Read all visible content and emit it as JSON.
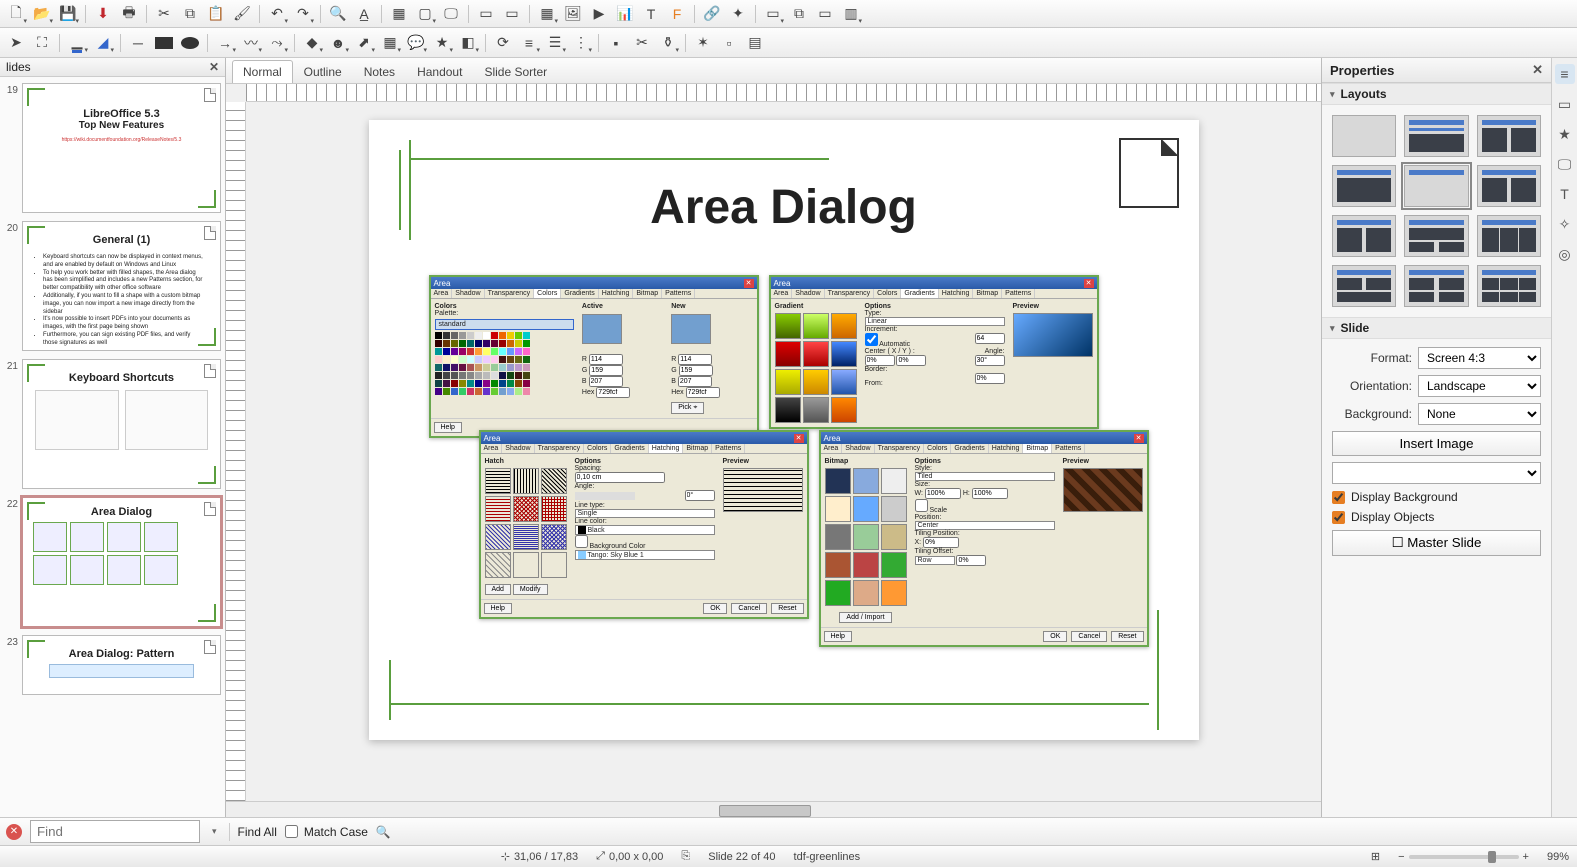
{
  "toolbar1": [
    "new",
    "open",
    "save",
    "pdf",
    "print",
    "cut",
    "copy",
    "paste",
    "clone",
    "undo",
    "redo",
    "find",
    "spell",
    "grid",
    "snap",
    "display",
    "nav",
    "nav2",
    "nav3",
    "table",
    "image",
    "media",
    "chart",
    "textbox",
    "fontwork",
    "hyperlink",
    "anim",
    "s1",
    "s2",
    "s3",
    "s4",
    "s5"
  ],
  "view_tabs": [
    "Normal",
    "Outline",
    "Notes",
    "Handout",
    "Slide Sorter"
  ],
  "active_view_tab": 0,
  "slides_panel": {
    "title": "lides"
  },
  "slides": [
    {
      "num": 19,
      "title": "LibreOffice 5.3",
      "subtitle": "Top New Features",
      "link": "https://wiki.documentfoundation.org/ReleaseNotes/5.3"
    },
    {
      "num": 20,
      "title": "General (1)",
      "bullets": [
        "Keyboard shortcuts can now be displayed in context menus, and are enabled by default on Windows and Linux",
        "To help you work better with filled shapes, the Area dialog has been simplified and includes a new Patterns section, for better compatibility with other office software",
        "Additionally, if you want to fill a shape with a custom bitmap image, you can now import a new image directly from the sidebar",
        "It's now possible to insert PDFs into your documents as images, with the first page being shown",
        "Furthermore, you can sign existing PDF files, and verify those signatures as well"
      ]
    },
    {
      "num": 21,
      "title": "Keyboard Shortcuts"
    },
    {
      "num": 22,
      "title": "Area Dialog",
      "selected": true
    },
    {
      "num": 23,
      "title": "Area Dialog: Pattern"
    }
  ],
  "canvas": {
    "title": "Area Dialog",
    "dialogs": {
      "colors": {
        "title": "Area",
        "tabs": [
          "Area",
          "Shadow",
          "Transparency",
          "Colors",
          "Gradients",
          "Hatching",
          "Bitmap",
          "Patterns"
        ],
        "active": 3,
        "labels": {
          "colors": "Colors",
          "active": "Active",
          "new": "New",
          "palette": "Palette:",
          "r": "R",
          "g": "G",
          "b": "B",
          "hex": "Hex"
        },
        "palette_value": "standard",
        "r": "114",
        "g": "159",
        "b": "207",
        "hex": "729fcf",
        "pick": "Pick ⌖",
        "help": "Help"
      },
      "gradients": {
        "title": "Area",
        "tabs": [
          "Area",
          "Shadow",
          "Transparency",
          "Colors",
          "Gradients",
          "Hatching",
          "Bitmap",
          "Patterns"
        ],
        "active": 4,
        "labels": {
          "gradient": "Gradient",
          "options": "Options",
          "preview": "Preview",
          "type": "Type:",
          "increment": "Increment:",
          "auto": "Automatic",
          "center": "Center ( X / Y ) :",
          "angle": "Angle:",
          "border": "Border:",
          "from": "From:"
        },
        "type_value": "Linear",
        "incr": "64",
        "cx": "0%",
        "cy": "0%",
        "angle": "30°",
        "border": "0%"
      },
      "hatching": {
        "title": "Area",
        "tabs": [
          "Area",
          "Shadow",
          "Transparency",
          "Colors",
          "Gradients",
          "Hatching",
          "Bitmap",
          "Patterns"
        ],
        "active": 5,
        "labels": {
          "hatch": "Hatch",
          "options": "Options",
          "preview": "Preview",
          "spacing": "Spacing:",
          "angle": "Angle:",
          "linetype": "Line type:",
          "linecolor": "Line color:",
          "bg": "Background Color"
        },
        "spacing": "0,10 cm",
        "angle": "0°",
        "linetype": "Single",
        "linecolor": "Black",
        "bgcolor": "Tango: Sky Blue 1",
        "add": "Add",
        "modify": "Modify",
        "help": "Help",
        "ok": "OK",
        "cancel": "Cancel",
        "reset": "Reset"
      },
      "bitmap": {
        "title": "Area",
        "tabs": [
          "Area",
          "Shadow",
          "Transparency",
          "Colors",
          "Gradients",
          "Hatching",
          "Bitmap",
          "Patterns"
        ],
        "active": 6,
        "labels": {
          "bitmap": "Bitmap",
          "options": "Options",
          "preview": "Preview",
          "style": "Style:",
          "size": "Size:",
          "w": "W:",
          "h": "H:",
          "scale": "Scale",
          "position": "Position:",
          "tilepos": "Tiling Position:",
          "x": "X:",
          "tileoff": "Tiling Offset:"
        },
        "style": "Tiled",
        "w": "100%",
        "h": "100%",
        "position": "Center",
        "x": "0%",
        "offset": "Row",
        "addimport": "Add / Import",
        "help": "Help",
        "ok": "OK",
        "cancel": "Cancel",
        "reset": "Reset"
      }
    }
  },
  "properties": {
    "title": "Properties",
    "layouts_title": "Layouts",
    "slide_title": "Slide",
    "format_label": "Format:",
    "format_value": "Screen 4:3",
    "orient_label": "Orientation:",
    "orient_value": "Landscape",
    "bg_label": "Background:",
    "bg_value": "None",
    "insert_image": "Insert Image",
    "disp_bg": "Display Background",
    "disp_bg_checked": true,
    "disp_obj": "Display Objects",
    "disp_obj_checked": true,
    "master": "Master Slide"
  },
  "findbar": {
    "placeholder": "Find",
    "find_all": "Find All",
    "match_case": "Match Case"
  },
  "status": {
    "coords": "31,06 / 17,83",
    "size": "0,00 x 0,00",
    "slide": "Slide 22 of 40",
    "template": "tdf-greenlines",
    "zoom": "99%"
  }
}
